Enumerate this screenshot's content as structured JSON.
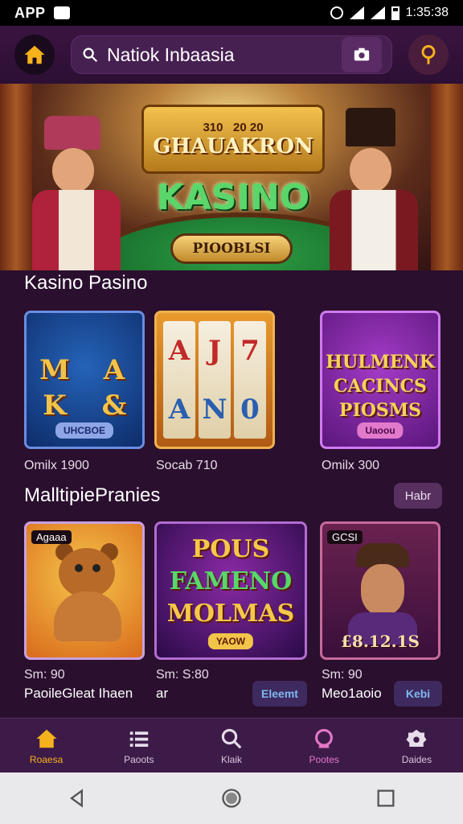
{
  "status": {
    "app": "APP",
    "time": "1:35:38"
  },
  "search": {
    "value": "Natiok Inbaasia"
  },
  "hero": {
    "badge_left": "310",
    "badge_right": "20 20",
    "sign": "GHAUAKRON",
    "title": "KASINO",
    "button": "PIOOBLSI"
  },
  "section1": {
    "title": "Kasino Pasino",
    "cards": [
      {
        "label": "Omilx 1900",
        "chip": "UHCBOE"
      },
      {
        "label": "Socab 710"
      },
      {
        "label": "Omilx 300",
        "text_lines": [
          "HULMENK",
          "CACINCS",
          "PIOSMS"
        ],
        "chip": "Uaoou"
      }
    ]
  },
  "section2": {
    "title": "MalltipiePranies",
    "more_button": "Habr",
    "cards": [
      {
        "tag": "Agaaa",
        "price": "Sm: 90",
        "name": "PaoileGleat Ihaen",
        "button": ""
      },
      {
        "title_lines": [
          "POUS",
          "FAMENO",
          "MOLMAS"
        ],
        "footer": "YAOW",
        "price": "Sm: S:80",
        "name": "ar",
        "button": "Eleemt"
      },
      {
        "tag": "GCSI",
        "banner": "£8.12.1S",
        "price": "Sm: 90",
        "name": "Meo1aoio",
        "button": "Kebi"
      }
    ]
  },
  "bottom_nav": [
    {
      "label": "Roaesa",
      "icon": "home-icon"
    },
    {
      "label": "Paoots",
      "icon": "list-icon"
    },
    {
      "label": "Klaik",
      "icon": "search-icon"
    },
    {
      "label": "Pootes",
      "icon": "chat-icon"
    },
    {
      "label": "Daides",
      "icon": "settings-icon"
    }
  ],
  "colors": {
    "accent": "#f6b21c",
    "background": "#2a0f2e"
  }
}
